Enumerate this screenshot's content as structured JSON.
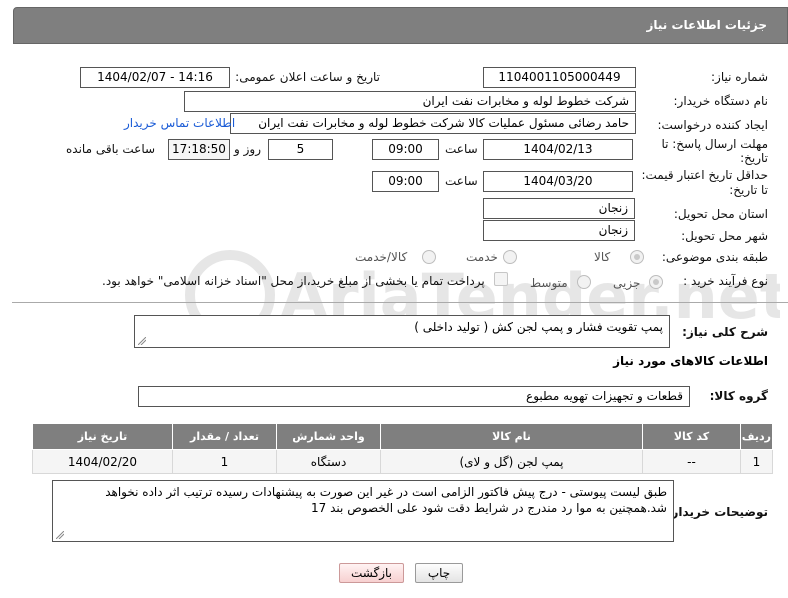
{
  "header": {
    "title": "جزئیات اطلاعات نیاز"
  },
  "fields": {
    "need_number": {
      "label": "شماره نیاز:",
      "value": "1104001105000449"
    },
    "announce_datetime": {
      "label": "تاریخ و ساعت اعلان عمومی:",
      "value": "1404/02/07 - 14:16"
    },
    "buyer_org": {
      "label": "نام دستگاه خریدار:",
      "value": "شرکت خطوط لوله و مخابرات نفت ایران"
    },
    "requester": {
      "label": "ایجاد کننده درخواست:",
      "value": "حامد  رضائی  مسئول عملیات کالا  شرکت خطوط لوله و مخابرات نفت ایران"
    },
    "contact_link": "اطلاعات تماس خریدار",
    "reply_deadline": {
      "label_line1": "مهلت ارسال پاسخ: تا",
      "label_line2": "تاریخ:",
      "date": "1404/02/13",
      "time_label": "ساعت",
      "time": "09:00",
      "days": "5",
      "days_label": "روز و",
      "remaining": "17:18:50",
      "remaining_label": "ساعت باقی مانده"
    },
    "price_validity": {
      "label_line1": "حداقل تاریخ اعتبار قیمت:",
      "label_line2": "تا تاریخ:",
      "date": "1404/03/20",
      "time_label": "ساعت",
      "time": "09:00"
    },
    "delivery_province": {
      "label": "استان محل تحویل:",
      "value": "زنجان"
    },
    "delivery_city": {
      "label": "شهر محل تحویل:",
      "value": "زنجان"
    },
    "category": {
      "label": "طبقه بندی موضوعی:",
      "options": [
        "کالا",
        "خدمت",
        "کالا/خدمت"
      ]
    },
    "purchase_process": {
      "label": "نوع فرآیند خرید :",
      "options": [
        "جزیی",
        "متوسط"
      ],
      "treasury_note": "پرداخت تمام یا بخشی از مبلغ خرید،از محل \"اسناد خزانه اسلامی\" خواهد بود."
    }
  },
  "description": {
    "label": "شرح کلی نیاز:",
    "value": "پمپ تقویت فشار و پمپ لجن کش ( تولید داخلی )"
  },
  "goods_section": {
    "title": "اطلاعات کالاهای مورد نیاز",
    "group_label": "گروه کالا:",
    "group_value": "قطعات و تجهیزات تهویه مطبوع"
  },
  "table": {
    "headers": [
      "ردیف",
      "کد کالا",
      "نام کالا",
      "واحد شمارش",
      "تعداد / مقدار",
      "تاریخ نیاز"
    ],
    "rows": [
      [
        "1",
        "--",
        "پمپ لجن (گل و لای)",
        "دستگاه",
        "1",
        "1404/02/20"
      ]
    ]
  },
  "buyer_notes": {
    "label": "توضیحات خریدار:",
    "value": "طبق لیست پیوستی - درج پیش فاکتور الزامی است در غیر این صورت به پیشنهادات رسیده ترتیب اثر داده نخواهد شد.همچنین به موا رد مندرج در شرایط دقت شود علی الخصوص بند 17"
  },
  "buttons": {
    "print": "چاپ",
    "back": "بازگشت"
  },
  "watermark": {
    "text": "AriaTender.net"
  },
  "colors": {
    "header_bg": "#7f7f7f",
    "link": "#1a5bd6",
    "table_header": "#7f7f7f"
  }
}
